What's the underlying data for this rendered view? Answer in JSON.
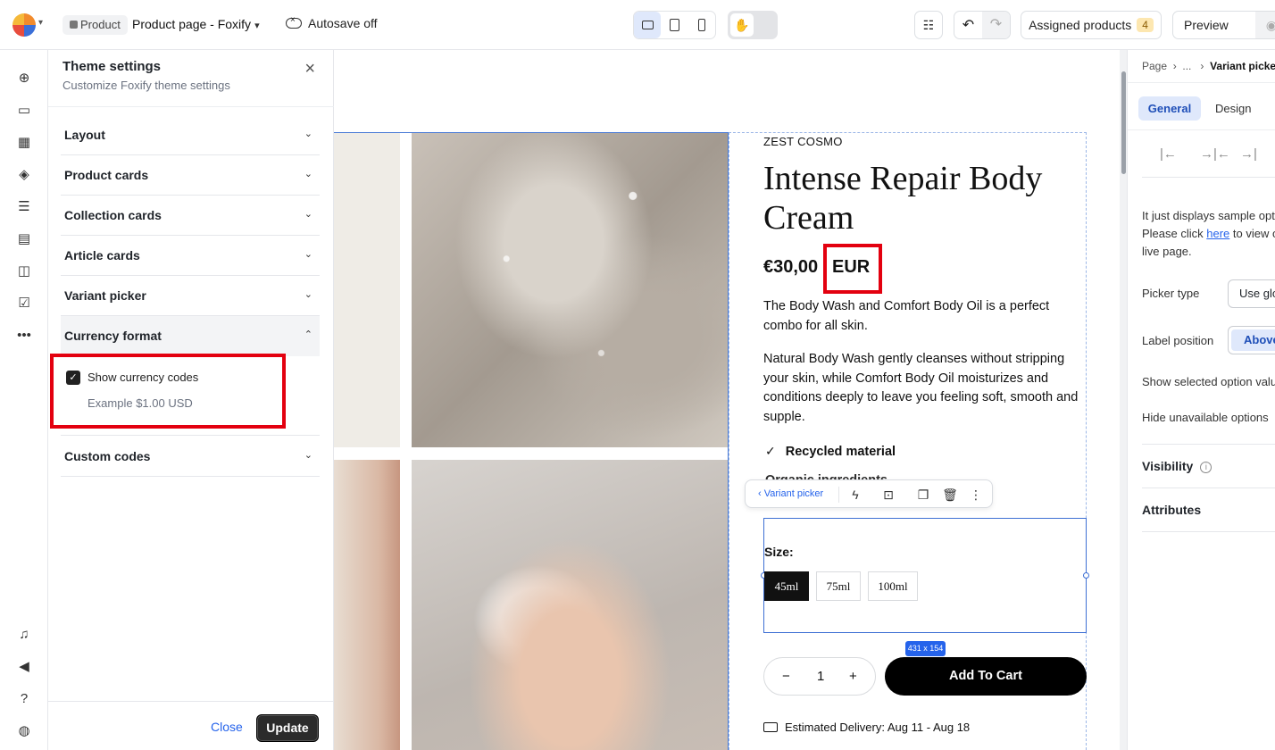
{
  "topbar": {
    "product_badge": "Product",
    "page_title": "Product page - Foxify",
    "autosave": "Autosave off",
    "assigned_label": "Assigned products",
    "assigned_count": "4",
    "preview_label": "Preview"
  },
  "theme_panel": {
    "title": "Theme settings",
    "subtitle": "Customize Foxify theme settings",
    "sections": [
      "Layout",
      "Product cards",
      "Collection cards",
      "Article cards",
      "Variant picker",
      "Currency format",
      "Custom codes"
    ],
    "currency": {
      "checkbox_label": "Show currency codes",
      "checked": true,
      "example": "Example $1.00 USD"
    },
    "close_label": "Close",
    "update_label": "Update"
  },
  "product": {
    "vendor": "ZEST COSMO",
    "title": "Intense Repair Body Cream",
    "price": "€30,00",
    "currency_code": "EUR",
    "description_1": "The Body Wash and Comfort Body Oil is a perfect combo for all skin.",
    "description_2": "Natural Body Wash gently cleanses without stripping your skin, while Comfort Body Oil moisturizes and conditions deeply to leave you feeling soft, smooth and supple.",
    "feature_1": "Recycled material",
    "feature_2": "Organic ingredients",
    "size_label": "Size:",
    "sizes": [
      "45ml",
      "75ml",
      "100ml"
    ],
    "selected_size": "45ml",
    "quantity": "1",
    "add_to_cart": "Add To Cart",
    "delivery": "Estimated Delivery: Aug 11 - Aug 18"
  },
  "floating_toolbar": {
    "back_label": "Variant picker",
    "dimensions": "431 x 154"
  },
  "inspector": {
    "breadcrumb_page": "Page",
    "breadcrumb_ellipsis": "...",
    "breadcrumb_current": "Variant picker",
    "tab_general": "General",
    "tab_design": "Design",
    "info_before_link": "It just displays sample options. Please click",
    "info_link": "here",
    "info_after_link": "to view on live page.",
    "picker_type_label": "Picker type",
    "picker_type_value": "Use global",
    "label_position_label": "Label position",
    "label_position_value": "Above",
    "show_selected_label": "Show selected option value",
    "hide_unavailable_label": "Hide unavailable options",
    "visibility_title": "Visibility",
    "attributes_title": "Attributes"
  },
  "colors": {
    "accent": "#2563eb",
    "highlight": "#e3000f",
    "button": "#000000"
  }
}
